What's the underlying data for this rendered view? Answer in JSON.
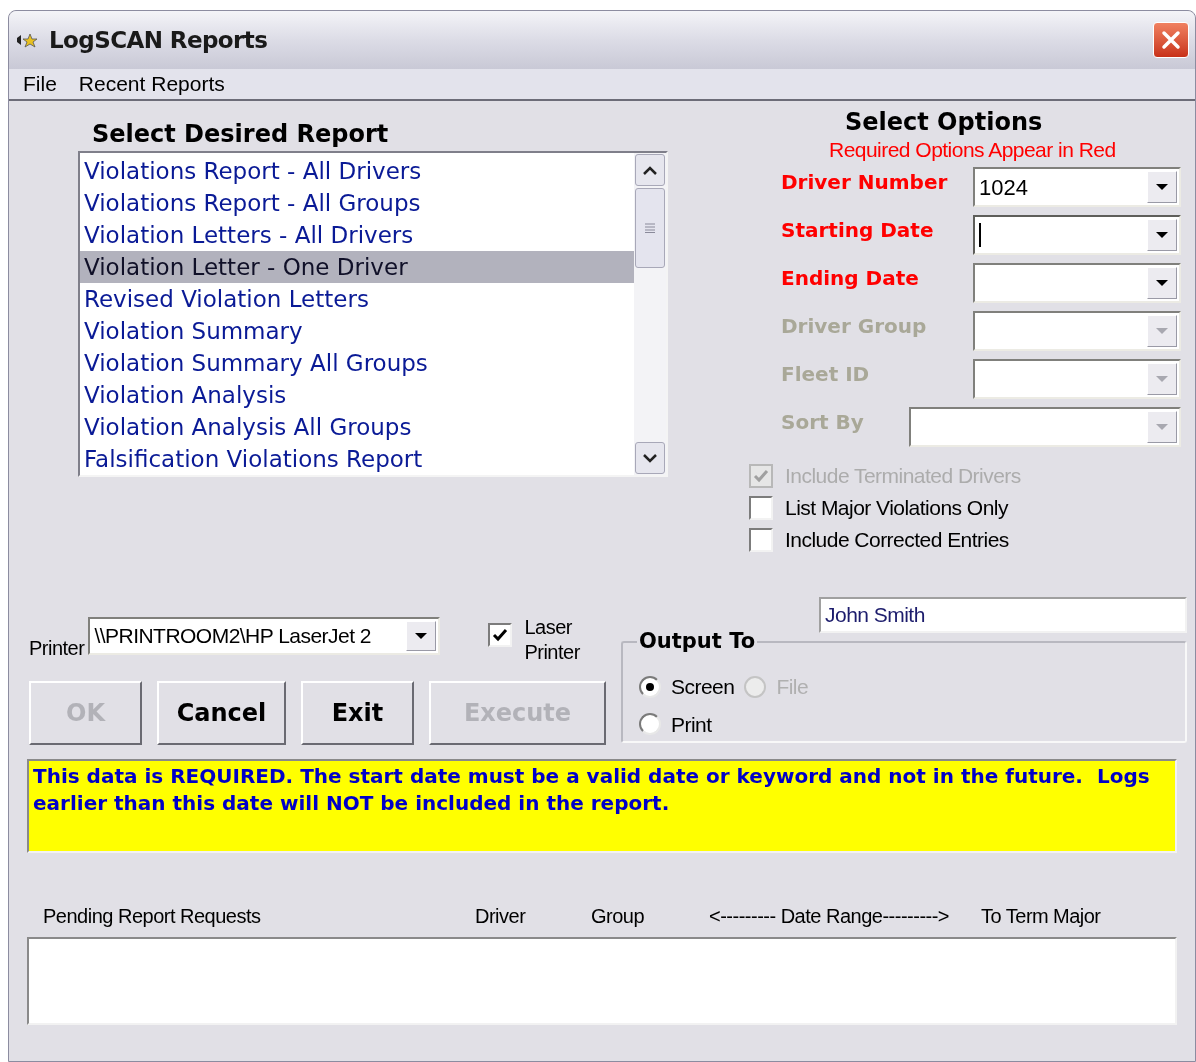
{
  "window": {
    "title": "LogSCAN Reports"
  },
  "menu": [
    {
      "label": "File"
    },
    {
      "label": "Recent Reports"
    }
  ],
  "report_list": {
    "heading": "Select Desired Report",
    "items": [
      {
        "label": "Violations Report - All Drivers",
        "selected": false
      },
      {
        "label": "Violations Report - All Groups",
        "selected": false
      },
      {
        "label": "Violation Letters - All Drivers",
        "selected": false
      },
      {
        "label": "Violation Letter - One Driver",
        "selected": true
      },
      {
        "label": "Revised Violation Letters",
        "selected": false
      },
      {
        "label": "Violation Summary",
        "selected": false
      },
      {
        "label": "Violation Summary All Groups",
        "selected": false
      },
      {
        "label": "Violation Analysis",
        "selected": false
      },
      {
        "label": "Violation Analysis All Groups",
        "selected": false
      },
      {
        "label": "Falsification Violations Report",
        "selected": false
      }
    ]
  },
  "options": {
    "heading": "Select Options",
    "note": "Required Options Appear in Red",
    "fields": [
      {
        "label": "Driver Number",
        "required": true,
        "disabled": false,
        "focused": false,
        "value": "1024"
      },
      {
        "label": "Starting Date",
        "required": true,
        "disabled": false,
        "focused": true
      },
      {
        "label": "Ending Date",
        "required": true,
        "disabled": false,
        "focused": false
      },
      {
        "label": "Driver Group",
        "required": false,
        "disabled": true,
        "focused": false
      },
      {
        "label": "Fleet ID",
        "required": false,
        "disabled": true,
        "focused": false
      },
      {
        "label": "Sort By",
        "required": false,
        "disabled": true,
        "focused": false
      }
    ],
    "checkboxes": [
      {
        "label": "Include Terminated Drivers",
        "checked": true,
        "disabled": true
      },
      {
        "label": "List Major Violations Only",
        "checked": false,
        "disabled": false
      },
      {
        "label": "Include Corrected Entries",
        "checked": false,
        "disabled": false
      }
    ]
  },
  "printer": {
    "label": "Printer",
    "value": "\\\\PRINTROOM2\\HP LaserJet 2",
    "laser": {
      "label": "Laser Printer",
      "checked": true
    }
  },
  "user_field": {
    "value": "John Smith"
  },
  "output_to": {
    "heading": "Output To",
    "options": [
      {
        "label": "Screen",
        "selected": true,
        "disabled": false
      },
      {
        "label": "File",
        "selected": false,
        "disabled": true
      },
      {
        "label": "Print",
        "selected": false,
        "disabled": false
      }
    ]
  },
  "buttons": [
    {
      "label": "OK",
      "disabled": true
    },
    {
      "label": "Cancel",
      "disabled": false
    },
    {
      "label": "Exit",
      "disabled": false
    },
    {
      "label": "Execute",
      "disabled": true
    }
  ],
  "message": "This data is REQUIRED. The start date must be a valid date or keyword and not in the future.  Logs earlier than this date will NOT be included in the report.",
  "pending": {
    "columns": [
      "Pending Report Requests",
      "Driver",
      "Group",
      "<--------- Date Range--------->",
      "To Term",
      "Major"
    ]
  }
}
